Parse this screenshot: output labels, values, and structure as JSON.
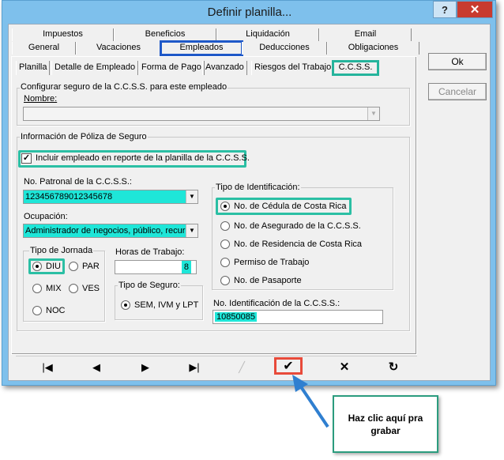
{
  "window": {
    "title": "Definir planilla...",
    "help": "?",
    "close": "✕"
  },
  "tabs_row1": [
    "Impuestos",
    "Beneficios",
    "Liquidación",
    "Email"
  ],
  "tabs_row2": [
    "General",
    "Vacaciones",
    "Empleados",
    "Deducciones",
    "Obligaciones"
  ],
  "subtabs": [
    "Planilla",
    "Detalle de Empleado",
    "Forma de Pago",
    "Avanzado",
    "Riesgos del Trabajo",
    "C.C.S.S."
  ],
  "section1": {
    "title": "Configurar seguro de la C.C.S.S. para este empleado",
    "nombre_label": "Nombre:",
    "nombre_value": ""
  },
  "section2": {
    "title": "Información de Póliza de Seguro",
    "include_label": "Incluir empleado en reporte de la planilla de la C.C.S.S.",
    "include_checked": true,
    "patronal_label": "No. Patronal de la C.C.S.S.:",
    "patronal_value": "123456789012345678",
    "ocupacion_label": "Ocupación:",
    "ocupacion_value": "Administrador de negocios, público, recur:",
    "jornada_title": "Tipo de Jornada",
    "jornada_options": [
      "DIU",
      "PAR",
      "MIX",
      "VES",
      "NOC"
    ],
    "jornada_selected": "DIU",
    "horas_label": "Horas de Trabajo:",
    "horas_value": "8",
    "seguro_title": "Tipo de Seguro:",
    "seguro_option": "SEM, IVM y LPT",
    "ident_title": "Tipo de Identificación:",
    "ident_options": [
      "No. de Cédula de Costa Rica",
      "No. de Asegurado de la C.C.S.S.",
      "No. de Residencia de Costa Rica",
      "Permiso de Trabajo",
      "No. de Pasaporte"
    ],
    "ident_selected": "No. de Cédula de Costa Rica",
    "ident_num_label": "No. Identificación de la C.C.S.S.:",
    "ident_num_value": "10850085"
  },
  "buttons": {
    "ok": "Ok",
    "cancel": "Cancelar"
  },
  "nav": {
    "first": "first-icon",
    "prev": "prev-icon",
    "next": "next-icon",
    "last": "last-icon",
    "edit": "edit-icon",
    "save": "check-icon",
    "delete": "delete-icon",
    "refresh": "refresh-icon"
  },
  "callout": "Haz clic aquí pra grabar",
  "colors": {
    "highlight_tab": "#1e58c8",
    "highlight": "#2bbfa4",
    "save_highlight": "#e84a3a",
    "field_cyan": "#1ee6d8",
    "arrow": "#2f7fd0"
  }
}
